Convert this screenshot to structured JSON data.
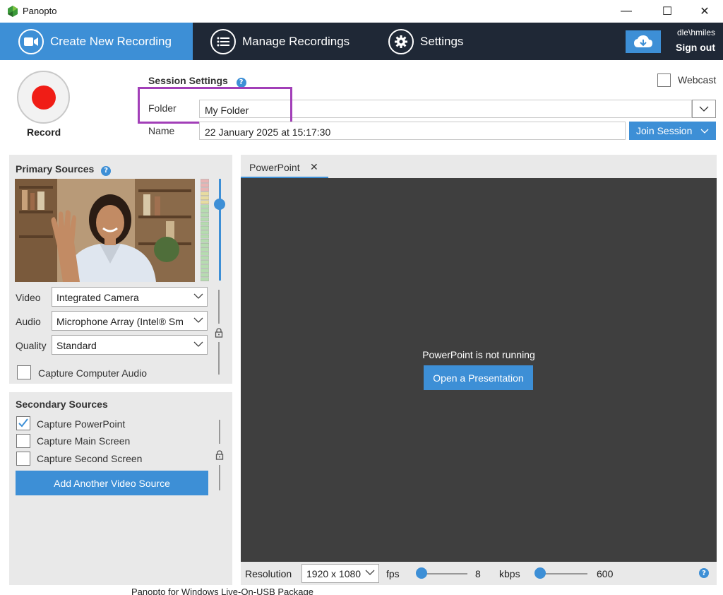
{
  "window": {
    "title": "Panopto",
    "minimize": "—",
    "maximize": "☐",
    "close": "✕"
  },
  "nav": {
    "tabs": [
      {
        "label": "Create New Recording",
        "icon": "camera-icon",
        "active": true
      },
      {
        "label": "Manage Recordings",
        "icon": "list-icon",
        "active": false
      },
      {
        "label": "Settings",
        "icon": "gear-icon",
        "active": false
      }
    ],
    "user": "dle\\hmiles",
    "sign_out": "Sign out"
  },
  "record": {
    "label": "Record"
  },
  "session": {
    "title": "Session Settings",
    "help": "?",
    "webcast_label": "Webcast",
    "webcast_checked": false,
    "folder_label": "Folder",
    "folder_value": "My Folder",
    "name_label": "Name",
    "name_value": "22 January 2025 at 15:17:30",
    "join_label": "Join Session"
  },
  "primary": {
    "title": "Primary Sources",
    "help": "?",
    "video_label": "Video",
    "video_value": "Integrated Camera",
    "audio_label": "Audio",
    "audio_value": "Microphone Array (Intel® Sm",
    "quality_label": "Quality",
    "quality_value": "Standard",
    "capture_audio_label": "Capture Computer Audio",
    "capture_audio_checked": false
  },
  "secondary": {
    "title": "Secondary Sources",
    "items": [
      {
        "label": "Capture PowerPoint",
        "checked": true
      },
      {
        "label": "Capture Main Screen",
        "checked": false
      },
      {
        "label": "Capture Second Screen",
        "checked": false
      }
    ],
    "add_label": "Add Another Video Source"
  },
  "powerpoint": {
    "tab_label": "PowerPoint",
    "tab_close": "✕",
    "status": "PowerPoint is not running",
    "open_label": "Open a Presentation"
  },
  "bottom": {
    "resolution_label": "Resolution",
    "resolution_value": "1920 x 1080",
    "fps_label": "fps",
    "fps_value": "8",
    "kbps_label": "kbps",
    "kbps_value": "600",
    "help": "?"
  },
  "footer_text": "Panopto for Windows Live-On-USB Package",
  "colors": {
    "accent": "#3d8fd6",
    "nav_bg": "#1f2836",
    "record": "#f01d16",
    "highlight": "#a23fb8"
  }
}
